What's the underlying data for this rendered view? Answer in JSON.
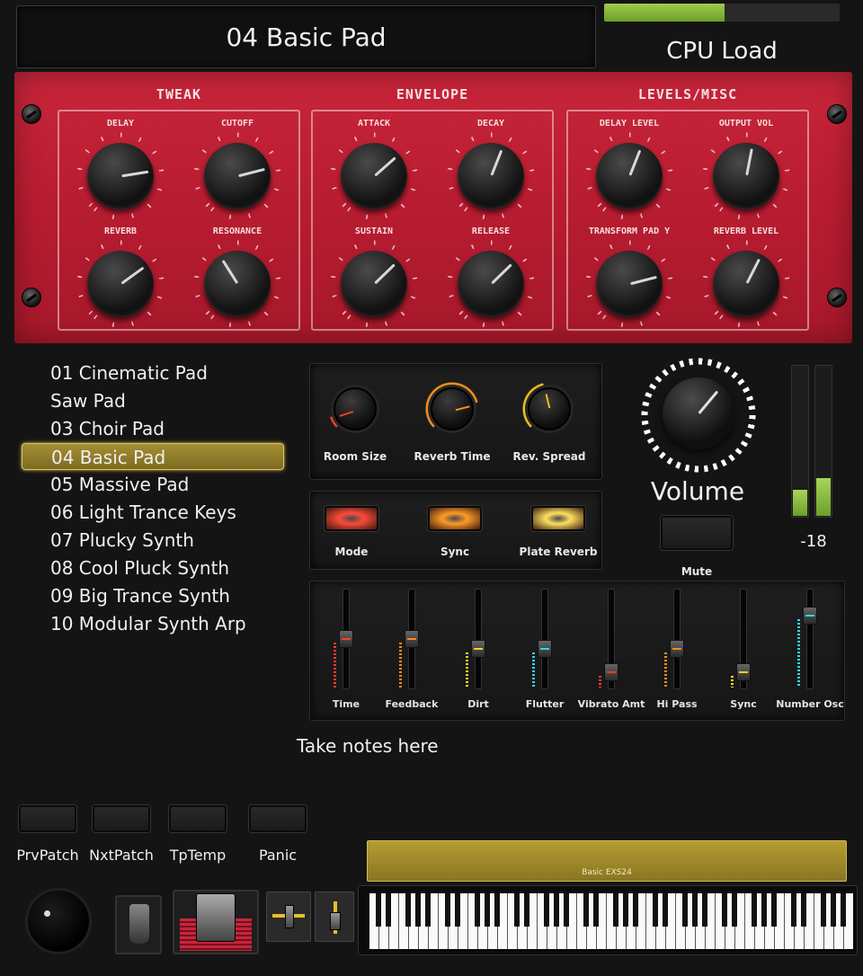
{
  "header": {
    "patch_name": "04 Basic Pad",
    "cpu_label": "CPU Load",
    "cpu_load": 0.51
  },
  "smart_controls": {
    "sections": [
      {
        "title": "TWEAK",
        "knobs": [
          {
            "label": "DELAY",
            "value": 0.8
          },
          {
            "label": "CUTOFF",
            "value": 0.78
          },
          {
            "label": "REVERB",
            "value": 0.7
          },
          {
            "label": "RESONANCE",
            "value": 0.38
          }
        ]
      },
      {
        "title": "ENVELOPE",
        "knobs": [
          {
            "label": "ATTACK",
            "value": 0.68
          },
          {
            "label": "DECAY",
            "value": 0.58
          },
          {
            "label": "SUSTAIN",
            "value": 0.67
          },
          {
            "label": "RELEASE",
            "value": 0.67
          }
        ]
      },
      {
        "title": "LEVELS/MISC",
        "knobs": [
          {
            "label": "DELAY LEVEL",
            "value": 0.58
          },
          {
            "label": "OUTPUT VOL",
            "value": 0.54
          },
          {
            "label": "TRANSFORM PAD Y",
            "value": 0.78
          },
          {
            "label": "REVERB LEVEL",
            "value": 0.6
          }
        ]
      }
    ]
  },
  "presets": {
    "items": [
      "01 Cinematic Pad",
      "Saw Pad",
      "03 Choir Pad",
      "04 Basic Pad",
      "05 Massive Pad",
      "06 Light Trance Keys",
      "07 Plucky Synth",
      "08 Cool Pluck Synth",
      "09 Big Trance Synth",
      "10 Modular Synth Arp"
    ],
    "selected_index": 3
  },
  "reverb": {
    "knobs": [
      {
        "label": "Room Size",
        "value": 0.1,
        "color": "#e8402a"
      },
      {
        "label": "Reverb Time",
        "value": 0.78,
        "color": "#f0901a"
      },
      {
        "label": "Rev. Spread",
        "value": 0.45,
        "color": "#e8c020"
      }
    ]
  },
  "modes": {
    "buttons": [
      {
        "label": "Mode",
        "color": "#ff4a3a"
      },
      {
        "label": "Sync",
        "color": "#ff9a26"
      },
      {
        "label": "Plate Reverb",
        "color": "#ffe060"
      }
    ]
  },
  "volume": {
    "label": "Volume",
    "mute_label": "Mute",
    "meter_value": "-18",
    "meter_levels": [
      0.17,
      0.25
    ]
  },
  "faders": {
    "items": [
      {
        "label": "Time",
        "value": 0.5,
        "color": "#ff3a2a"
      },
      {
        "label": "Feedback",
        "value": 0.5,
        "color": "#ff8a1a"
      },
      {
        "label": "Dirt",
        "value": 0.38,
        "color": "#ffd020"
      },
      {
        "label": "Flutter",
        "value": 0.38,
        "color": "#30d8e8"
      },
      {
        "label": "Vibrato Amt",
        "value": 0.1,
        "color": "#ff3a2a"
      },
      {
        "label": "Hi Pass",
        "value": 0.38,
        "color": "#ff8a1a"
      },
      {
        "label": "Sync",
        "value": 0.1,
        "color": "#ffd020"
      },
      {
        "label": "Number Osc",
        "value": 0.78,
        "color": "#30d8e8"
      }
    ]
  },
  "notes": {
    "text": "Take notes here"
  },
  "transport": {
    "buttons": [
      "PrvPatch",
      "NxtPatch",
      "TpTemp",
      "Panic"
    ]
  },
  "keyboard": {
    "instrument_name": "Basic EXS24"
  }
}
